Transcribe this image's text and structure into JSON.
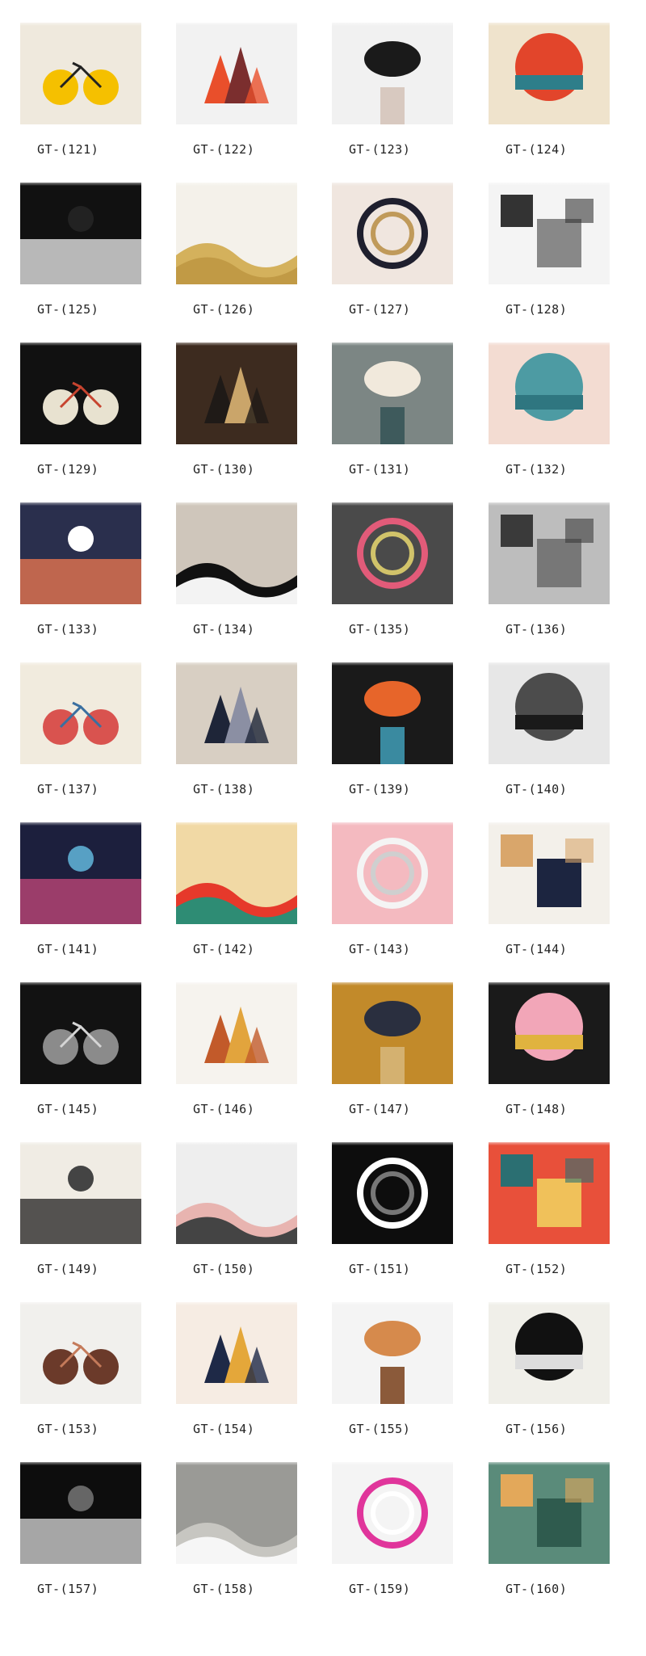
{
  "items": [
    {
      "code": "GT-(121)",
      "colors": [
        "#efe9dd",
        "#f5c000",
        "#222222"
      ],
      "icon": "bicycle-lemon-wheels-icon"
    },
    {
      "code": "GT-(122)",
      "colors": [
        "#f2f2f2",
        "#e94f2b",
        "#7b2e2e"
      ],
      "icon": "geometric-mountains-sun-icon"
    },
    {
      "code": "GT-(123)",
      "colors": [
        "#f1f1f1",
        "#1a1a1a",
        "#d8c9c0"
      ],
      "icon": "butterfly-face-icon"
    },
    {
      "code": "GT-(124)",
      "colors": [
        "#efe3cc",
        "#e2452b",
        "#2e7e8a"
      ],
      "icon": "rocket-sunset-icon"
    },
    {
      "code": "GT-(125)",
      "colors": [
        "#111111",
        "#ffffff",
        "#222222"
      ],
      "icon": "ufo-get-in-loser-icon"
    },
    {
      "code": "GT-(126)",
      "colors": [
        "#f4f1ea",
        "#d4b15c",
        "#c19a45"
      ],
      "icon": "golden-leaves-icon"
    },
    {
      "code": "GT-(127)",
      "colors": [
        "#f0e6df",
        "#1f1f2e",
        "#c09a5a"
      ],
      "icon": "tattooed-handshake-icon"
    },
    {
      "code": "GT-(128)",
      "colors": [
        "#f4f4f4",
        "#333333",
        "#888888"
      ],
      "icon": "dinosaur-skulls-icon"
    },
    {
      "code": "GT-(129)",
      "colors": [
        "#111111",
        "#e8e2d0",
        "#c7442f"
      ],
      "icon": "vinyl-mountains-icon"
    },
    {
      "code": "GT-(130)",
      "colors": [
        "#3d2b1f",
        "#1f1a17",
        "#caa56a"
      ],
      "icon": "classical-portrait-icon"
    },
    {
      "code": "GT-(131)",
      "colors": [
        "#7c8684",
        "#f1e9dc",
        "#3e5a5c"
      ],
      "icon": "whale-ship-clouds-icon"
    },
    {
      "code": "GT-(132)",
      "colors": [
        "#f3dcd2",
        "#4d9ba3",
        "#2f7680"
      ],
      "icon": "ocean-waves-icon"
    },
    {
      "code": "GT-(133)",
      "colors": [
        "#2a2f4d",
        "#ff7e4f",
        "#ffffff"
      ],
      "icon": "sunset-text-icon"
    },
    {
      "code": "GT-(134)",
      "colors": [
        "#cfc6bb",
        "#111111",
        "#f3f3f3"
      ],
      "icon": "woman-flowers-circle-icon"
    },
    {
      "code": "GT-(135)",
      "colors": [
        "#4a4a4a",
        "#e25b79",
        "#d1c36a"
      ],
      "icon": "plane-flowers-icon"
    },
    {
      "code": "GT-(136)",
      "colors": [
        "#bdbdbd",
        "#3a3a3a",
        "#777777"
      ],
      "icon": "bison-city-icon"
    },
    {
      "code": "GT-(137)",
      "colors": [
        "#f1ebde",
        "#d9534f",
        "#3a6fa0"
      ],
      "icon": "mandala-icon"
    },
    {
      "code": "GT-(138)",
      "colors": [
        "#d8cfc3",
        "#1e2538",
        "#8b8fa3"
      ],
      "icon": "great-wave-circle-icon"
    },
    {
      "code": "GT-(139)",
      "colors": [
        "#1a1a1a",
        "#e7652a",
        "#3a8aa0"
      ],
      "icon": "concentric-rings-icon"
    },
    {
      "code": "GT-(140)",
      "colors": [
        "#e7e7e7",
        "#4c4c4c",
        "#1a1a1a"
      ],
      "icon": "misty-forest-icon"
    },
    {
      "code": "GT-(141)",
      "colors": [
        "#1c1f3d",
        "#d14a7e",
        "#57a0c4"
      ],
      "icon": "lantern-castle-icon"
    },
    {
      "code": "GT-(142)",
      "colors": [
        "#f1d9a5",
        "#e6392b",
        "#2e8c74"
      ],
      "icon": "sun-green-mountains-icon"
    },
    {
      "code": "GT-(143)",
      "colors": [
        "#f4bac0",
        "#f4f4f4",
        "#cfcfcf"
      ],
      "icon": "llama-unicorn-icon"
    },
    {
      "code": "GT-(144)",
      "colors": [
        "#f3f0ea",
        "#d9a66b",
        "#1c2540"
      ],
      "icon": "moon-waves-icon"
    },
    {
      "code": "GT-(145)",
      "colors": [
        "#121212",
        "#8b8b8b",
        "#d5d5d5"
      ],
      "icon": "peeking-cat-icon"
    },
    {
      "code": "GT-(146)",
      "colors": [
        "#f6f3ee",
        "#c25a2a",
        "#e2a43d"
      ],
      "icon": "llama-pattern-icon"
    },
    {
      "code": "GT-(147)",
      "colors": [
        "#c28a2a",
        "#2a2f3f",
        "#d4b170"
      ],
      "icon": "classical-officer-portrait-icon"
    },
    {
      "code": "GT-(148)",
      "colors": [
        "#1a1a1a",
        "#f2a6b8",
        "#e0b33f"
      ],
      "icon": "painted-lady-icon"
    },
    {
      "code": "GT-(149)",
      "colors": [
        "#f0ece4",
        "#111111",
        "#444444"
      ],
      "icon": "diver-icon"
    },
    {
      "code": "GT-(150)",
      "colors": [
        "#eeeeee",
        "#e8b4b0",
        "#444444"
      ],
      "icon": "triangle-pattern-icon"
    },
    {
      "code": "GT-(151)",
      "colors": [
        "#0d0d0d",
        "#ffffff",
        "#777777"
      ],
      "icon": "astronaut-space-icon"
    },
    {
      "code": "GT-(152)",
      "colors": [
        "#e8503a",
        "#2b6f72",
        "#f0c15a"
      ],
      "icon": "retro-waves-icon"
    },
    {
      "code": "GT-(153)",
      "colors": [
        "#f1f0ed",
        "#6b3a2a",
        "#c47a5a"
      ],
      "icon": "painted-strips-icon"
    },
    {
      "code": "GT-(154)",
      "colors": [
        "#f6ece3",
        "#1e2947",
        "#e4a73a"
      ],
      "icon": "abstract-paint-icon"
    },
    {
      "code": "GT-(155)",
      "colors": [
        "#f4f4f4",
        "#d68a4c",
        "#8b5a3a"
      ],
      "icon": "fawn-icon"
    },
    {
      "code": "GT-(156)",
      "colors": [
        "#f0efe9",
        "#111111",
        "#dddddd"
      ],
      "icon": "mystic-hands-moon-icon"
    },
    {
      "code": "GT-(157)",
      "colors": [
        "#0d0d0d",
        "#e8e8e8",
        "#666666"
      ],
      "icon": "night-landscape-icon"
    },
    {
      "code": "GT-(158)",
      "colors": [
        "#9a9a96",
        "#c7c6c1",
        "#f6f6f6"
      ],
      "icon": "concrete-texture-icon"
    },
    {
      "code": "GT-(159)",
      "colors": [
        "#f4f4f4",
        "#e0359b",
        "#ffffff"
      ],
      "icon": "dripping-lips-icon"
    },
    {
      "code": "GT-(160)",
      "colors": [
        "#5a8b7a",
        "#e3a85a",
        "#2f5b4e"
      ],
      "icon": "pug-pattern-icon"
    }
  ]
}
